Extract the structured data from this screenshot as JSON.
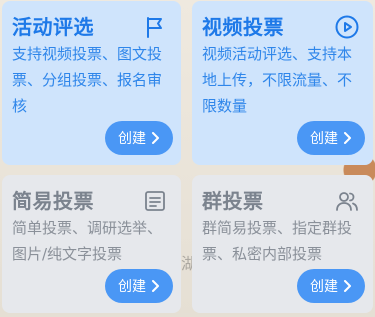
{
  "cards": [
    {
      "title": "活动评选",
      "desc": "支持视频投票、图文投票、分组投票、报名审核",
      "button_label": "创建",
      "icon": "flag-icon",
      "style": "blue"
    },
    {
      "title": "视频投票",
      "desc": "视频活动评选、支持本地上传，不限流量、不限数量",
      "button_label": "创建",
      "icon": "play-icon",
      "style": "blue"
    },
    {
      "title": "简易投票",
      "desc": "简单投票、调研选举、图片/纯文字投票",
      "button_label": "创建",
      "icon": "form-icon",
      "style": "gray"
    },
    {
      "title": "群投票",
      "desc": "群简易投票、指定群投票、私密内部投票",
      "button_label": "创建",
      "icon": "group-icon",
      "style": "gray"
    }
  ],
  "colors": {
    "blue_card_bg": "#cfe4fc",
    "gray_card_bg": "#e6e8ec",
    "blue_title": "#1e79e8",
    "gray_title": "#7b838e",
    "button_bg": "#4a97f5"
  }
}
